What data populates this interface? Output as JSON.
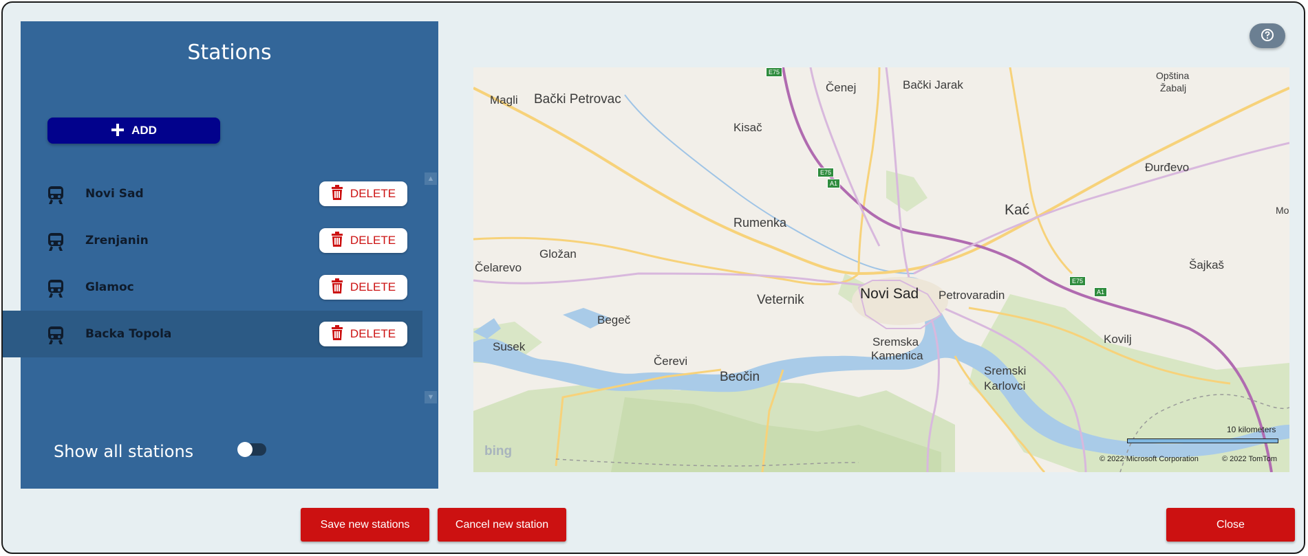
{
  "panel": {
    "title": "Stations",
    "add_label": "ADD",
    "stations": [
      {
        "name": "Novi Sad",
        "delete_label": "DELETE"
      },
      {
        "name": "Zrenjanin",
        "delete_label": "DELETE"
      },
      {
        "name": "Glamoc",
        "delete_label": "DELETE"
      },
      {
        "name": "Backa Topola",
        "delete_label": "DELETE"
      }
    ],
    "selected_station": "Backa Topola",
    "show_all_label": "Show all stations",
    "show_all_on": false
  },
  "map": {
    "labels": {
      "magli": "Magli",
      "backi_petrovac": "Bački Petrovac",
      "cenej": "Čenej",
      "backi_jarak": "Bački Jarak",
      "opstina": "Opština",
      "zabalj": "Žabalj",
      "kisac": "Kisač",
      "djurdjevo": "Đurđevo",
      "kac": "Kać",
      "mo": "Mo",
      "rumenka": "Rumenka",
      "glozan": "Gložan",
      "celarevo": "Čelarevo",
      "sajkas": "Šajkaš",
      "veternik": "Veternik",
      "novi_sad": "Novi Sad",
      "petrovaradin": "Petrovaradin",
      "begec": "Begeč",
      "susek": "Susek",
      "kovilj": "Kovilj",
      "sremska": "Sremska",
      "kamenica": "Kamenica",
      "cerevi": "Čerevi",
      "beocin": "Beočin",
      "sremski": "Sremski",
      "karlovci": "Karlovci",
      "e75": "E75",
      "a1": "A1"
    },
    "scale_label": "10 kilometers",
    "copyright_ms": "© 2022 Microsoft Corporation",
    "copyright_tt": "© 2022 TomTom",
    "provider": "bing"
  },
  "footer": {
    "save_label": "Save new stations",
    "cancel_label": "Cancel new station",
    "close_label": "Close"
  },
  "colors": {
    "panel_bg": "#336699",
    "add_button": "#02028c",
    "danger": "#cc1111",
    "dialog_bg": "#e7eff2"
  }
}
